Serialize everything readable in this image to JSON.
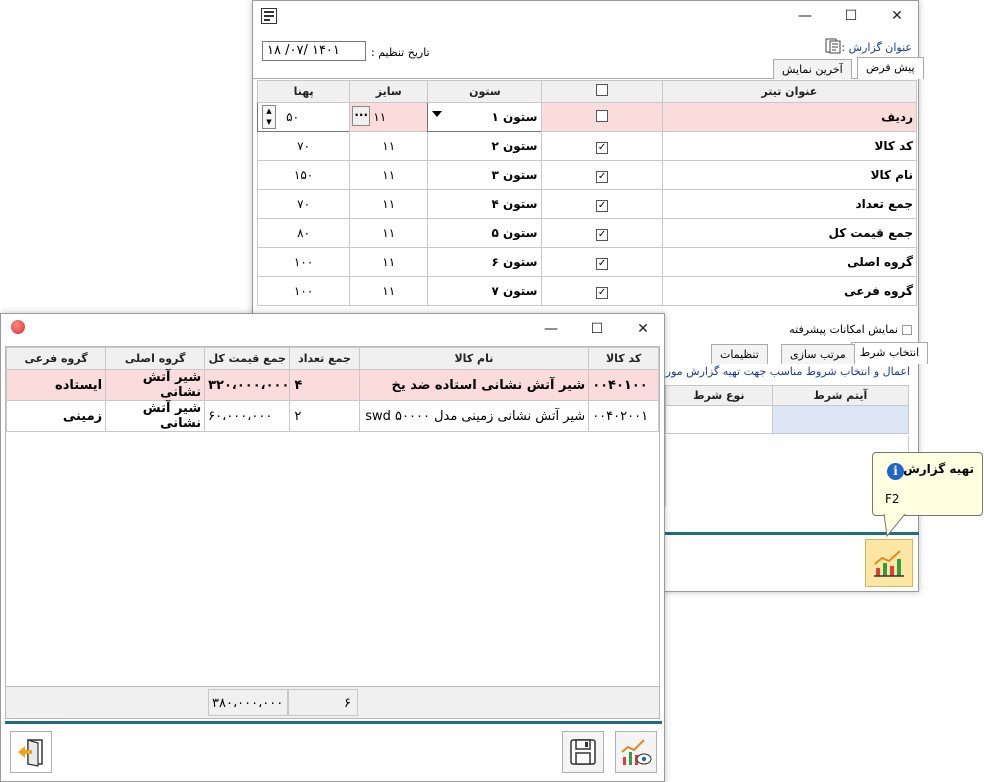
{
  "settings_window": {
    "title_bar": {
      "minimize": "—",
      "maximize": "☐",
      "close": "✕"
    },
    "report_title_label": "عنوان گزارش :",
    "date_label": "تاریخ تنظیم :",
    "date_value": "۱۴۰۱ /۰۷/ ۱۸",
    "tabs": [
      "پیش فرض",
      "آخرین نمایش"
    ],
    "columns_header": {
      "caption_title": "عنوان تیتر",
      "column": "ستون",
      "size": "سایز",
      "width": "پهنا"
    },
    "rows": [
      {
        "caption": "ردیف",
        "checked": false,
        "column": "ستون ۱",
        "size": "۱۱",
        "width": "۵۰",
        "editing": true
      },
      {
        "caption": "کد کالا",
        "checked": true,
        "column": "ستون ۲",
        "size": "۱۱",
        "width": "۷۰"
      },
      {
        "caption": "نام کالا",
        "checked": true,
        "column": "ستون ۳",
        "size": "۱۱",
        "width": "۱۵۰"
      },
      {
        "caption": "جمع تعداد",
        "checked": true,
        "column": "ستون ۴",
        "size": "۱۱",
        "width": "۷۰"
      },
      {
        "caption": "جمع قیمت کل",
        "checked": true,
        "column": "ستون ۵",
        "size": "۱۱",
        "width": "۸۰"
      },
      {
        "caption": "گروه اصلی",
        "checked": true,
        "column": "ستون ۶",
        "size": "۱۱",
        "width": "۱۰۰"
      },
      {
        "caption": "گروه فرعی",
        "checked": true,
        "column": "ستون ۷",
        "size": "۱۱",
        "width": "۱۰۰"
      }
    ],
    "advanced_label": "نمایش امکانات پیشرفته",
    "lower_tabs": [
      "انتخاب شرط",
      "مرتب سازی",
      "تنظیمات"
    ],
    "condition_hint": "اعمال و انتخاب شروط مناسب جهت تهیه گزارش  مورد",
    "condition_headers": {
      "item": "آیتم شرط",
      "type": "نوع شرط"
    },
    "tooltip": {
      "title": "تهیه گزارش",
      "shortcut": "F2"
    }
  },
  "report_window": {
    "title_bar": {
      "minimize": "—",
      "maximize": "☐",
      "close": "✕"
    },
    "headers": {
      "code": "کد کالا",
      "name": "نام کالا",
      "qty": "جمع تعداد",
      "total": "جمع قیمت کل",
      "main_group": "گروه اصلی",
      "sub_group": "گروه فرعی"
    },
    "rows": [
      {
        "code": "۰۰۴۰۱۰۰",
        "name": "شیر آتش نشانی استاده ضد یخ",
        "qty": "۴",
        "total": "۳۲۰،۰۰۰،۰۰۰",
        "main_group": "شیر آتش نشانی",
        "sub_group": "ایستاده"
      },
      {
        "code": "۰۰۴۰۲۰۰۱",
        "name": "شیر آتش نشانی زمینی مدل ۵۰۰۰۰ swd",
        "qty": "۲",
        "total": "۶۰،۰۰۰،۰۰۰",
        "main_group": "شیر آتش نشانی",
        "sub_group": "زمینی"
      }
    ],
    "footer": {
      "qty_sum": "۶",
      "total_sum": "۳۸۰،۰۰۰،۰۰۰"
    }
  },
  "colors": {
    "selected_row": "#fadcdc",
    "accent_line": "#1f6f78",
    "tooltip_bg": "#ffffe1",
    "condition_cell": "#dde6f5"
  }
}
